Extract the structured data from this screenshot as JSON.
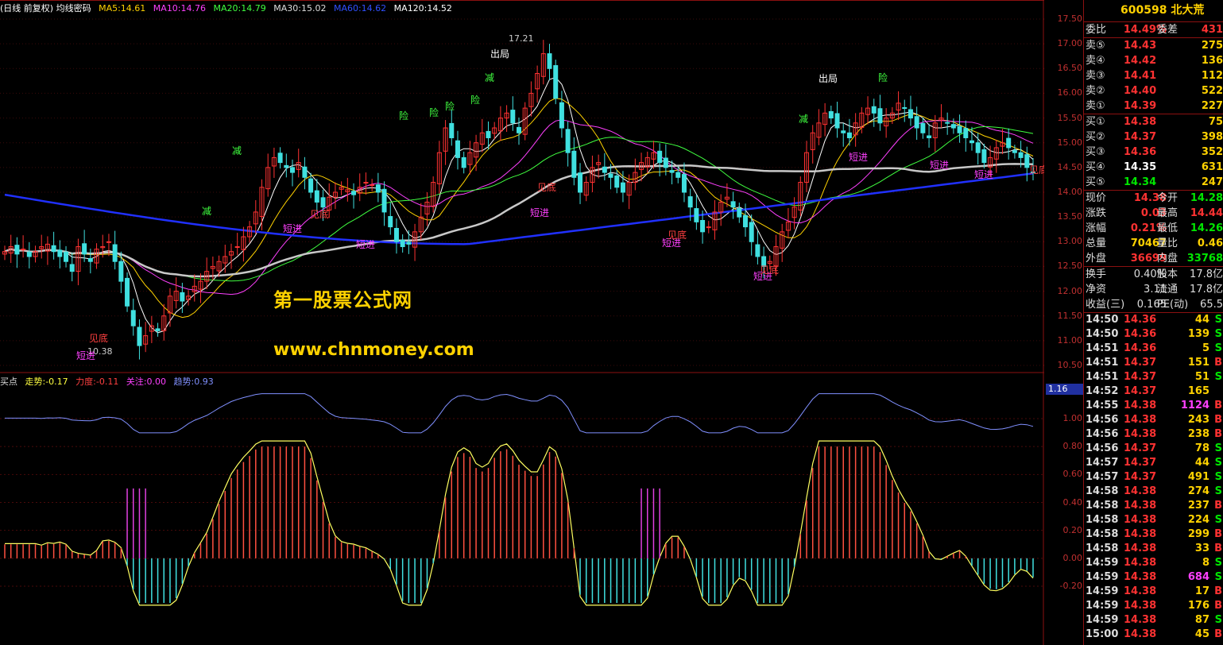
{
  "header": {
    "title": "(日线 前复权) 均线密码",
    "ma5": "MA5:14.61",
    "ma10": "MA10:14.76",
    "ma20": "MA20:14.79",
    "ma30": "MA30:15.02",
    "ma60": "MA60:14.62",
    "ma120": "MA120:14.52"
  },
  "indicator": {
    "name": "买点",
    "trend": "走势:-0.17",
    "force": "力度:-0.11",
    "focus": "关注:0.00",
    "tendency": "趋势:0.93",
    "current_value_box": "1.16"
  },
  "watermark": {
    "line1": "第一股票公式网",
    "line2": "www.chnmoney.com"
  },
  "price_axis": [
    "17.50",
    "17.00",
    "16.50",
    "16.00",
    "15.50",
    "15.00",
    "14.50",
    "14.00",
    "13.50",
    "13.00",
    "12.50",
    "12.00",
    "11.50",
    "11.00",
    "10.50"
  ],
  "ind_axis": [
    "1.00",
    "0.80",
    "0.60",
    "0.40",
    "0.20",
    "0.00",
    "-0.20"
  ],
  "annotations": {
    "high_label": "17.21",
    "low_label": "10.38",
    "chu_ju_1": "出局",
    "chu_ju_2": "出局",
    "xian": "险",
    "jian": "减",
    "duan_jin": "短进",
    "chao_di": "见底"
  },
  "stock": {
    "code": "600598",
    "name": "北大荒"
  },
  "quote": {
    "weibi_label": "委比",
    "weibi_value": "14.49%",
    "weicha_label": "委差",
    "weicha_value": "431"
  },
  "sell_orders": [
    {
      "label": "卖⑤",
      "price": "14.43",
      "vol": "275"
    },
    {
      "label": "卖④",
      "price": "14.42",
      "vol": "136"
    },
    {
      "label": "卖③",
      "price": "14.41",
      "vol": "112"
    },
    {
      "label": "卖②",
      "price": "14.40",
      "vol": "522"
    },
    {
      "label": "卖①",
      "price": "14.39",
      "vol": "227"
    }
  ],
  "buy_orders": [
    {
      "label": "买①",
      "price": "14.38",
      "vol": "75",
      "color": "#ff3232"
    },
    {
      "label": "买②",
      "price": "14.37",
      "vol": "398",
      "color": "#ff3232"
    },
    {
      "label": "买③",
      "price": "14.36",
      "vol": "352",
      "color": "#ff3232"
    },
    {
      "label": "买④",
      "price": "14.35",
      "vol": "631",
      "color": "#ffffff"
    },
    {
      "label": "买⑤",
      "price": "14.34",
      "vol": "247",
      "color": "#00e600"
    }
  ],
  "stats": [
    {
      "l1": "现价",
      "v1": "14.38",
      "c1": "#ff3232",
      "l2": "今开",
      "v2": "14.28",
      "c2": "#00e600"
    },
    {
      "l1": "涨跌",
      "v1": "0.03",
      "c1": "#ff3232",
      "l2": "最高",
      "v2": "14.44",
      "c2": "#ff3232"
    },
    {
      "l1": "涨幅",
      "v1": "0.21%",
      "c1": "#ff3232",
      "l2": "最低",
      "v2": "14.26",
      "c2": "#00e600"
    },
    {
      "l1": "总量",
      "v1": "70467",
      "c1": "#ffd200",
      "l2": "量比",
      "v2": "0.46",
      "c2": "#ffd200"
    },
    {
      "l1": "外盘",
      "v1": "36699",
      "c1": "#ff3232",
      "l2": "内盘",
      "v2": "33768",
      "c2": "#00e600"
    }
  ],
  "stats2": [
    {
      "l1": "换手",
      "v1": "0.40%",
      "l2": "股本",
      "v2": "17.8亿"
    },
    {
      "l1": "净资",
      "v1": "3.11",
      "l2": "流通",
      "v2": "17.8亿"
    },
    {
      "l1": "收益(三)",
      "v1": "0.165",
      "l2": "PE(动)",
      "v2": "65.5"
    }
  ],
  "trades": [
    {
      "time": "14:50",
      "price": "14.36",
      "vol": "44",
      "bs": "S"
    },
    {
      "time": "14:50",
      "price": "14.36",
      "vol": "139",
      "bs": "S"
    },
    {
      "time": "14:51",
      "price": "14.36",
      "vol": "5",
      "bs": "S"
    },
    {
      "time": "14:51",
      "price": "14.37",
      "vol": "151",
      "bs": "B"
    },
    {
      "time": "14:51",
      "price": "14.37",
      "vol": "51",
      "bs": "S"
    },
    {
      "time": "14:52",
      "price": "14.37",
      "vol": "165",
      "bs": ""
    },
    {
      "time": "14:55",
      "price": "14.38",
      "vol": "1124",
      "bs": "B"
    },
    {
      "time": "14:56",
      "price": "14.38",
      "vol": "243",
      "bs": "B"
    },
    {
      "time": "14:56",
      "price": "14.38",
      "vol": "238",
      "bs": "B"
    },
    {
      "time": "14:56",
      "price": "14.37",
      "vol": "78",
      "bs": "S"
    },
    {
      "time": "14:57",
      "price": "14.37",
      "vol": "44",
      "bs": "S"
    },
    {
      "time": "14:57",
      "price": "14.37",
      "vol": "491",
      "bs": "S"
    },
    {
      "time": "14:58",
      "price": "14.38",
      "vol": "274",
      "bs": "S"
    },
    {
      "time": "14:58",
      "price": "14.38",
      "vol": "237",
      "bs": "B"
    },
    {
      "time": "14:58",
      "price": "14.38",
      "vol": "224",
      "bs": "S"
    },
    {
      "time": "14:58",
      "price": "14.38",
      "vol": "299",
      "bs": "B"
    },
    {
      "time": "14:58",
      "price": "14.38",
      "vol": "33",
      "bs": "B"
    },
    {
      "time": "14:59",
      "price": "14.38",
      "vol": "8",
      "bs": "S"
    },
    {
      "time": "14:59",
      "price": "14.38",
      "vol": "684",
      "bs": "S"
    },
    {
      "time": "14:59",
      "price": "14.38",
      "vol": "17",
      "bs": "B"
    },
    {
      "time": "14:59",
      "price": "14.38",
      "vol": "176",
      "bs": "B"
    },
    {
      "time": "14:59",
      "price": "14.38",
      "vol": "87",
      "bs": "S"
    },
    {
      "time": "15:00",
      "price": "14.38",
      "vol": "45",
      "bs": "B"
    }
  ],
  "chart_data": {
    "type": "candlestick",
    "price_ylim": [
      10.3,
      17.6
    ],
    "indicator_ylim": [
      -0.35,
      1.2
    ],
    "closes": [
      12.8,
      12.9,
      12.75,
      12.85,
      12.7,
      12.8,
      12.9,
      12.95,
      12.8,
      12.7,
      12.6,
      12.4,
      12.9,
      12.75,
      12.6,
      12.85,
      12.9,
      13.0,
      12.6,
      12.2,
      11.7,
      11.3,
      10.9,
      11.1,
      11.3,
      11.2,
      11.5,
      11.9,
      12.0,
      11.8,
      11.9,
      12.1,
      12.2,
      12.4,
      12.5,
      12.6,
      12.7,
      12.8,
      12.9,
      13.1,
      13.3,
      13.6,
      14.1,
      14.5,
      14.7,
      14.6,
      14.5,
      14.4,
      14.6,
      14.3,
      14.0,
      13.8,
      13.7,
      13.9,
      14.0,
      14.1,
      14.05,
      13.95,
      14.1,
      14.2,
      14.15,
      14.0,
      13.6,
      13.3,
      13.0,
      12.9,
      12.95,
      13.2,
      13.5,
      13.8,
      14.2,
      14.8,
      15.3,
      15.1,
      14.7,
      14.5,
      14.8,
      15.0,
      15.2,
      15.1,
      15.3,
      15.5,
      15.6,
      15.4,
      15.2,
      15.7,
      16.0,
      16.4,
      16.8,
      16.5,
      15.9,
      15.3,
      14.8,
      14.3,
      14.0,
      14.2,
      14.5,
      14.6,
      14.4,
      14.3,
      14.1,
      14.0,
      14.2,
      14.4,
      14.6,
      14.7,
      14.8,
      14.6,
      14.5,
      14.4,
      14.3,
      14.0,
      13.7,
      13.4,
      13.2,
      13.3,
      13.6,
      13.8,
      13.9,
      13.7,
      13.5,
      13.3,
      13.0,
      12.7,
      12.5,
      12.6,
      12.9,
      13.2,
      13.4,
      13.7,
      14.2,
      14.8,
      15.2,
      15.4,
      15.6,
      15.5,
      15.3,
      15.2,
      15.1,
      15.4,
      15.6,
      15.7,
      15.6,
      15.4,
      15.5,
      15.6,
      15.8,
      15.7,
      15.5,
      15.3,
      15.2,
      15.1,
      15.4,
      15.5,
      15.4,
      15.3,
      15.2,
      15.1,
      15.0,
      14.8,
      14.6,
      14.7,
      14.9,
      15.0,
      14.9,
      14.8,
      14.7,
      14.5,
      14.4
    ]
  }
}
